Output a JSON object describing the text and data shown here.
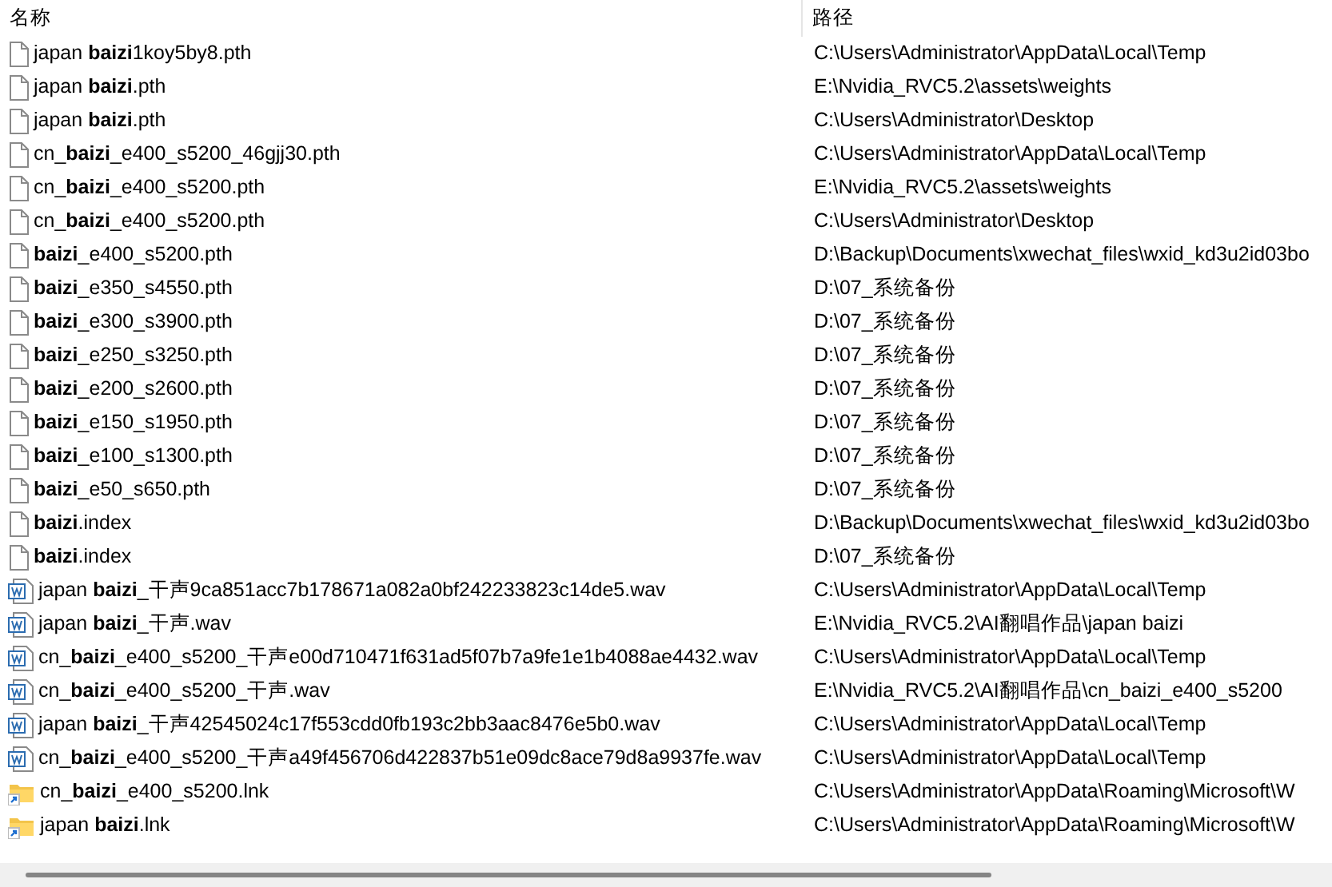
{
  "columns": [
    "名称",
    "路径"
  ],
  "rows": [
    {
      "kind": "file",
      "name": "japan **baizi**1koy5by8.pth",
      "path": "C:\\Users\\Administrator\\AppData\\Local\\Temp"
    },
    {
      "kind": "file",
      "name": "japan **baizi**.pth",
      "path": "E:\\Nvidia_RVC5.2\\assets\\weights"
    },
    {
      "kind": "file",
      "name": "japan **baizi**.pth",
      "path": "C:\\Users\\Administrator\\Desktop"
    },
    {
      "kind": "file",
      "name": "cn_**baizi**_e400_s5200_46gjj30.pth",
      "path": "C:\\Users\\Administrator\\AppData\\Local\\Temp"
    },
    {
      "kind": "file",
      "name": "cn_**baizi**_e400_s5200.pth",
      "path": "E:\\Nvidia_RVC5.2\\assets\\weights"
    },
    {
      "kind": "file",
      "name": "cn_**baizi**_e400_s5200.pth",
      "path": "C:\\Users\\Administrator\\Desktop"
    },
    {
      "kind": "file",
      "name": "**baizi**_e400_s5200.pth",
      "path": "D:\\Backup\\Documents\\xwechat_files\\wxid_kd3u2id03bo"
    },
    {
      "kind": "file",
      "name": "**baizi**_e350_s4550.pth",
      "path": "D:\\07_系统备份"
    },
    {
      "kind": "file",
      "name": "**baizi**_e300_s3900.pth",
      "path": "D:\\07_系统备份"
    },
    {
      "kind": "file",
      "name": "**baizi**_e250_s3250.pth",
      "path": "D:\\07_系统备份"
    },
    {
      "kind": "file",
      "name": "**baizi**_e200_s2600.pth",
      "path": "D:\\07_系统备份"
    },
    {
      "kind": "file",
      "name": "**baizi**_e150_s1950.pth",
      "path": "D:\\07_系统备份"
    },
    {
      "kind": "file",
      "name": "**baizi**_e100_s1300.pth",
      "path": "D:\\07_系统备份"
    },
    {
      "kind": "file",
      "name": "**baizi**_e50_s650.pth",
      "path": "D:\\07_系统备份"
    },
    {
      "kind": "file",
      "name": "**baizi**.index",
      "path": "D:\\Backup\\Documents\\xwechat_files\\wxid_kd3u2id03bo"
    },
    {
      "kind": "file",
      "name": "**baizi**.index",
      "path": "D:\\07_系统备份"
    },
    {
      "kind": "audio",
      "name": "japan **baizi**_干声9ca851acc7b178671a082a0bf242233823c14de5.wav",
      "path": "C:\\Users\\Administrator\\AppData\\Local\\Temp"
    },
    {
      "kind": "audio",
      "name": "japan **baizi**_干声.wav",
      "path": "E:\\Nvidia_RVC5.2\\AI翻唱作品\\japan baizi"
    },
    {
      "kind": "audio",
      "name": "cn_**baizi**_e400_s5200_干声e00d710471f631ad5f07b7a9fe1e1b4088ae4432.wav",
      "path": "C:\\Users\\Administrator\\AppData\\Local\\Temp"
    },
    {
      "kind": "audio",
      "name": "cn_**baizi**_e400_s5200_干声.wav",
      "path": "E:\\Nvidia_RVC5.2\\AI翻唱作品\\cn_baizi_e400_s5200"
    },
    {
      "kind": "audio",
      "name": "japan **baizi**_干声42545024c17f553cdd0fb193c2bb3aac8476e5b0.wav",
      "path": "C:\\Users\\Administrator\\AppData\\Local\\Temp"
    },
    {
      "kind": "audio",
      "name": "cn_**baizi**_e400_s5200_干声a49f456706d422837b51e09dc8ace79d8a9937fe.wav",
      "path": "C:\\Users\\Administrator\\AppData\\Local\\Temp"
    },
    {
      "kind": "shortcut",
      "name": "cn_**baizi**_e400_s5200.lnk",
      "path": "C:\\Users\\Administrator\\AppData\\Roaming\\Microsoft\\W"
    },
    {
      "kind": "shortcut",
      "name": "japan **baizi**.lnk",
      "path": "C:\\Users\\Administrator\\AppData\\Roaming\\Microsoft\\W"
    }
  ]
}
